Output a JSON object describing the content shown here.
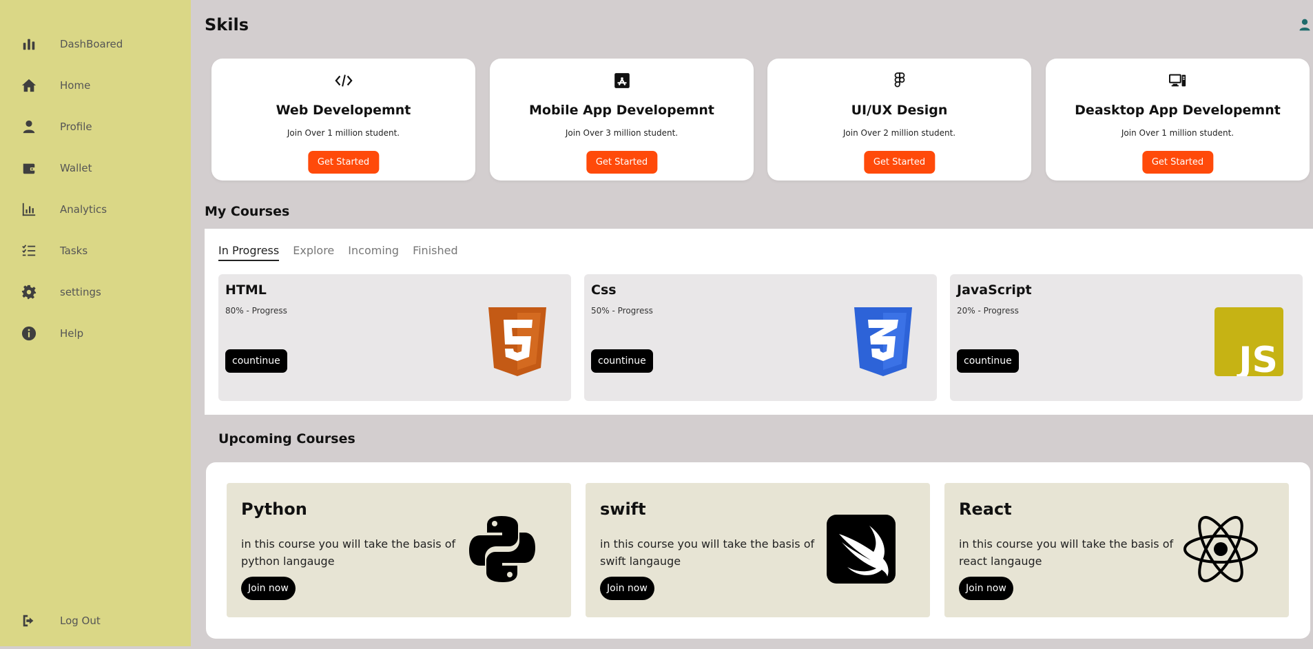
{
  "sidebar": {
    "items": [
      {
        "label": "DashBoared",
        "icon": "bar-chart-icon"
      },
      {
        "label": "Home",
        "icon": "home-icon"
      },
      {
        "label": "Profile",
        "icon": "user-icon"
      },
      {
        "label": "Wallet",
        "icon": "wallet-icon"
      },
      {
        "label": "Analytics",
        "icon": "analytics-icon"
      },
      {
        "label": "Tasks",
        "icon": "tasks-icon"
      },
      {
        "label": "settings",
        "icon": "gear-icon"
      },
      {
        "label": "Help",
        "icon": "info-icon"
      }
    ],
    "logout": {
      "label": "Log Out",
      "icon": "logout-icon"
    }
  },
  "skills": {
    "title": "Skils",
    "cards": [
      {
        "title": "Web Developemnt",
        "subtitle": "Join Over 1 million student.",
        "button": "Get Started",
        "icon": "code-icon"
      },
      {
        "title": "Mobile App Developemnt",
        "subtitle": "Join Over 3 million student.",
        "button": "Get Started",
        "icon": "app-store-icon"
      },
      {
        "title": "UI/UX Design",
        "subtitle": "Join Over 2 million student.",
        "button": "Get Started",
        "icon": "figma-icon"
      },
      {
        "title": "Deasktop App Developemnt",
        "subtitle": "Join Over 1 million student.",
        "button": "Get Started",
        "icon": "desktop-icon"
      }
    ]
  },
  "my_courses": {
    "title": "My Courses",
    "tabs": [
      "In Progress",
      "Explore",
      "Incoming",
      "Finished"
    ],
    "active_tab": "In Progress",
    "courses": [
      {
        "title": "HTML",
        "progress": "80% - Progress",
        "progress_value": 80,
        "button": "countinue",
        "logo": "html5-logo",
        "color": "#c45a15"
      },
      {
        "title": "Css",
        "progress": "50% - Progress",
        "progress_value": 50,
        "button": "countinue",
        "logo": "css3-logo",
        "color": "#2d63d8"
      },
      {
        "title": "JavaScript",
        "progress": "20% - Progress",
        "progress_value": 20,
        "button": "countinue",
        "logo": "js-logo",
        "color": "#c6b314"
      }
    ]
  },
  "upcoming": {
    "title": "Upcoming Courses",
    "courses": [
      {
        "title": "Python",
        "description": "in this course you will take the basis of python langauge",
        "button": "Join now",
        "logo": "python-logo"
      },
      {
        "title": "swift",
        "description": "in this course you will take the basis of swift langauge",
        "button": "Join now",
        "logo": "swift-logo"
      },
      {
        "title": "React",
        "description": "in this course you will take the basis of react langauge",
        "button": "Join now",
        "logo": "react-logo"
      }
    ]
  },
  "colors": {
    "sidebar_bg": "#dad786",
    "page_bg": "#d3cecf",
    "accent_orange": "#ff4a0a",
    "upcoming_card_bg": "#e7e4d4"
  }
}
